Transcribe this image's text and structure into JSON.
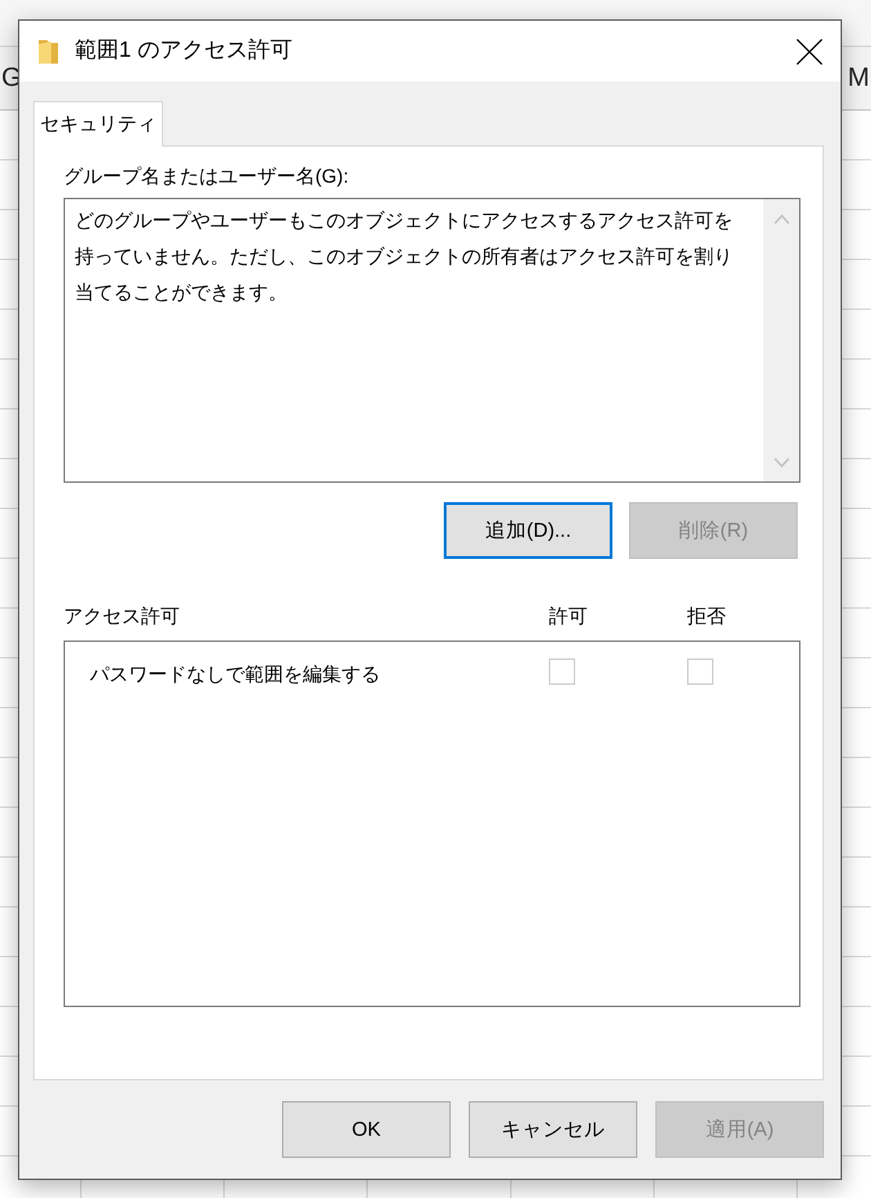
{
  "spreadsheet": {
    "column_headers": [
      "G",
      "M"
    ]
  },
  "dialog": {
    "title": "範囲1 のアクセス許可",
    "tabs": [
      {
        "label": "セキュリティ",
        "selected": true
      }
    ],
    "group_section": {
      "label": "グループ名またはユーザー名(G):",
      "message": "どのグループやユーザーもこのオブジェクトにアクセスするアクセス許可を持っていません。ただし、このオブジェクトの所有者はアクセス許可を割り当てることができます。",
      "buttons": [
        {
          "label": "追加(D)...",
          "disabled": false,
          "focused": true
        },
        {
          "label": "削除(R)",
          "disabled": true,
          "focused": false
        }
      ]
    },
    "permissions": {
      "label": "アクセス許可",
      "columns": [
        "許可",
        "拒否"
      ],
      "rows": [
        {
          "name": "パスワードなしで範囲を編集する",
          "allow": false,
          "deny": false,
          "disabled": true
        }
      ]
    },
    "buttons": [
      {
        "label": "OK",
        "disabled": false,
        "focused": false
      },
      {
        "label": "キャンセル",
        "disabled": false,
        "focused": false
      },
      {
        "label": "適用(A)",
        "disabled": true,
        "focused": false
      }
    ]
  }
}
